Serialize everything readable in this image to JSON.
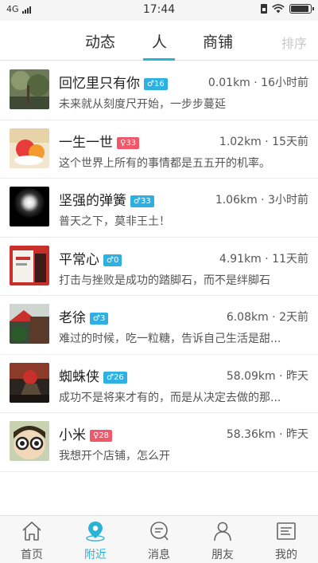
{
  "status_bar": {
    "network": "4G",
    "time": "17:44",
    "battery_level": 0.9
  },
  "tabs": [
    {
      "label": "动态",
      "active": false
    },
    {
      "label": "人",
      "active": true
    },
    {
      "label": "商铺",
      "active": false
    }
  ],
  "sort_label": "排序",
  "colors": {
    "accent": "#2bb3d6",
    "male_badge": "#2fb0e2",
    "female_badge": "#f0586a"
  },
  "people": [
    {
      "name": "回忆里只有你",
      "gender": "male",
      "badge": "♂16",
      "meta": "0.01km · 16小时前",
      "signature": "未来就从刻度尺开始，一步步蔓延"
    },
    {
      "name": "一生一世",
      "gender": "female",
      "badge": "♀33",
      "meta": "1.02km · 15天前",
      "signature": "这个世界上所有的事情都是五五开的机率。"
    },
    {
      "name": "坚强的弹簧",
      "gender": "male",
      "badge": "♂33",
      "meta": "1.06km · 3小时前",
      "signature": "普天之下，莫非王土！"
    },
    {
      "name": "平常心",
      "gender": "male",
      "badge": "♂0",
      "meta": "4.91km · 11天前",
      "signature": "打击与挫败是成功的踏脚石，而不是绊脚石"
    },
    {
      "name": "老徐",
      "gender": "male",
      "badge": "♂3",
      "meta": "6.08km · 2天前",
      "signature": "难过的时候，吃一粒糖，告诉自己生活是甜..."
    },
    {
      "name": "蜘蛛侠",
      "gender": "male",
      "badge": "♂26",
      "meta": "58.09km · 昨天",
      "signature": "成功不是将来才有的，而是从决定去做的那..."
    },
    {
      "name": "小米",
      "gender": "female",
      "badge": "♀28",
      "meta": "58.36km · 昨天",
      "signature": "我想开个店铺，怎么开"
    }
  ],
  "bottom_nav": [
    {
      "label": "首页",
      "icon": "home-icon",
      "active": false
    },
    {
      "label": "附近",
      "icon": "location-pin-icon",
      "active": true
    },
    {
      "label": "消息",
      "icon": "message-icon",
      "active": false
    },
    {
      "label": "朋友",
      "icon": "friends-icon",
      "active": false
    },
    {
      "label": "我的",
      "icon": "profile-card-icon",
      "active": false
    }
  ]
}
